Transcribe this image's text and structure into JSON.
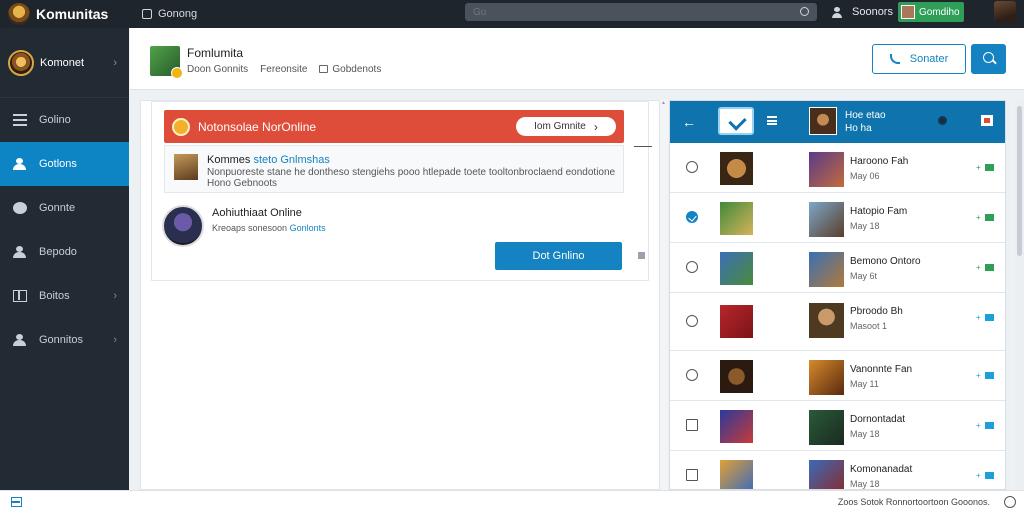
{
  "app": {
    "brand": "Komunitas",
    "top_nav_label": "Gonong",
    "search_placeholder": "Gu",
    "user_label": "Soonors",
    "badge_label": "Gomdiho"
  },
  "sidebar": {
    "profile_name": "Komonet",
    "items": [
      {
        "label": "Golino"
      },
      {
        "label": "Gotlons"
      },
      {
        "label": "Gonnte"
      },
      {
        "label": "Bepodo"
      },
      {
        "label": "Boitos"
      },
      {
        "label": "Gonnitos"
      }
    ]
  },
  "header": {
    "title": "Fomlumita",
    "meta": [
      "Doon Gonnits",
      "Fereonsite",
      "Gobdenots"
    ],
    "btn_outline_label": "Sonater"
  },
  "main": {
    "alert_text": "Notonsolae NorOnline",
    "alert_button": "Iom Gmnite",
    "notice_title_a": "Kommes ",
    "notice_title_b": "steto Gnlmshas",
    "notice_body": "Nonpuoreste stane he dontheso stengiehs pooo htlepade toete tooltonbroclaend eondotione Hono Gebnoots",
    "user_name": "Aohiuthiaat Online",
    "user_meta_a": "Kreoaps sonesoon",
    "user_meta_b": "Gonlonts",
    "primary_button": "Dot Gnlino"
  },
  "right_panel": {
    "head_name_1": "Hoe etao",
    "head_name_2": "Ho ha",
    "rows": [
      {
        "name": "Haroono Fah",
        "sub": "May 06",
        "status": "green"
      },
      {
        "name": "Hatopio Fam",
        "sub": "May 18",
        "status": "green"
      },
      {
        "name": "Bemono Ontoro",
        "sub": "May 6t",
        "status": "green"
      },
      {
        "name": "Pbroodo Bh",
        "sub": "Masoot 1",
        "status": "blue"
      },
      {
        "name": "Vanonnte Fan",
        "sub": "May 11",
        "status": "blue"
      },
      {
        "name": "Dornontadat",
        "sub": "May 18",
        "status": "blue"
      },
      {
        "name": "Komonanadat",
        "sub": "May 18",
        "status": "blue"
      }
    ]
  },
  "footer": {
    "text": "Zoos Sotok Ronnortoortoon Gooonos."
  }
}
